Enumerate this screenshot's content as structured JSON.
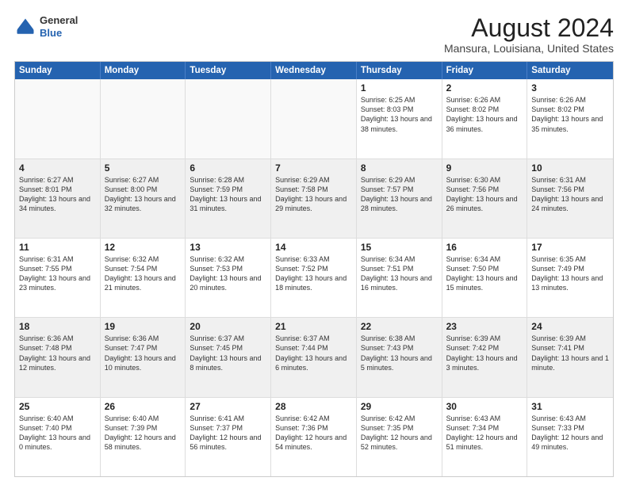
{
  "logo": {
    "general": "General",
    "blue": "Blue"
  },
  "title": "August 2024",
  "subtitle": "Mansura, Louisiana, United States",
  "header_days": [
    "Sunday",
    "Monday",
    "Tuesday",
    "Wednesday",
    "Thursday",
    "Friday",
    "Saturday"
  ],
  "rows": [
    [
      {
        "day": "",
        "empty": true,
        "text": ""
      },
      {
        "day": "",
        "empty": true,
        "text": ""
      },
      {
        "day": "",
        "empty": true,
        "text": ""
      },
      {
        "day": "",
        "empty": true,
        "text": ""
      },
      {
        "day": "1",
        "text": "Sunrise: 6:25 AM\nSunset: 8:03 PM\nDaylight: 13 hours\nand 38 minutes."
      },
      {
        "day": "2",
        "text": "Sunrise: 6:26 AM\nSunset: 8:02 PM\nDaylight: 13 hours\nand 36 minutes."
      },
      {
        "day": "3",
        "text": "Sunrise: 6:26 AM\nSunset: 8:02 PM\nDaylight: 13 hours\nand 35 minutes."
      }
    ],
    [
      {
        "day": "4",
        "text": "Sunrise: 6:27 AM\nSunset: 8:01 PM\nDaylight: 13 hours\nand 34 minutes."
      },
      {
        "day": "5",
        "text": "Sunrise: 6:27 AM\nSunset: 8:00 PM\nDaylight: 13 hours\nand 32 minutes."
      },
      {
        "day": "6",
        "text": "Sunrise: 6:28 AM\nSunset: 7:59 PM\nDaylight: 13 hours\nand 31 minutes."
      },
      {
        "day": "7",
        "text": "Sunrise: 6:29 AM\nSunset: 7:58 PM\nDaylight: 13 hours\nand 29 minutes."
      },
      {
        "day": "8",
        "text": "Sunrise: 6:29 AM\nSunset: 7:57 PM\nDaylight: 13 hours\nand 28 minutes."
      },
      {
        "day": "9",
        "text": "Sunrise: 6:30 AM\nSunset: 7:56 PM\nDaylight: 13 hours\nand 26 minutes."
      },
      {
        "day": "10",
        "text": "Sunrise: 6:31 AM\nSunset: 7:56 PM\nDaylight: 13 hours\nand 24 minutes."
      }
    ],
    [
      {
        "day": "11",
        "text": "Sunrise: 6:31 AM\nSunset: 7:55 PM\nDaylight: 13 hours\nand 23 minutes."
      },
      {
        "day": "12",
        "text": "Sunrise: 6:32 AM\nSunset: 7:54 PM\nDaylight: 13 hours\nand 21 minutes."
      },
      {
        "day": "13",
        "text": "Sunrise: 6:32 AM\nSunset: 7:53 PM\nDaylight: 13 hours\nand 20 minutes."
      },
      {
        "day": "14",
        "text": "Sunrise: 6:33 AM\nSunset: 7:52 PM\nDaylight: 13 hours\nand 18 minutes."
      },
      {
        "day": "15",
        "text": "Sunrise: 6:34 AM\nSunset: 7:51 PM\nDaylight: 13 hours\nand 16 minutes."
      },
      {
        "day": "16",
        "text": "Sunrise: 6:34 AM\nSunset: 7:50 PM\nDaylight: 13 hours\nand 15 minutes."
      },
      {
        "day": "17",
        "text": "Sunrise: 6:35 AM\nSunset: 7:49 PM\nDaylight: 13 hours\nand 13 minutes."
      }
    ],
    [
      {
        "day": "18",
        "text": "Sunrise: 6:36 AM\nSunset: 7:48 PM\nDaylight: 13 hours\nand 12 minutes."
      },
      {
        "day": "19",
        "text": "Sunrise: 6:36 AM\nSunset: 7:47 PM\nDaylight: 13 hours\nand 10 minutes."
      },
      {
        "day": "20",
        "text": "Sunrise: 6:37 AM\nSunset: 7:45 PM\nDaylight: 13 hours\nand 8 minutes."
      },
      {
        "day": "21",
        "text": "Sunrise: 6:37 AM\nSunset: 7:44 PM\nDaylight: 13 hours\nand 6 minutes."
      },
      {
        "day": "22",
        "text": "Sunrise: 6:38 AM\nSunset: 7:43 PM\nDaylight: 13 hours\nand 5 minutes."
      },
      {
        "day": "23",
        "text": "Sunrise: 6:39 AM\nSunset: 7:42 PM\nDaylight: 13 hours\nand 3 minutes."
      },
      {
        "day": "24",
        "text": "Sunrise: 6:39 AM\nSunset: 7:41 PM\nDaylight: 13 hours\nand 1 minute."
      }
    ],
    [
      {
        "day": "25",
        "text": "Sunrise: 6:40 AM\nSunset: 7:40 PM\nDaylight: 13 hours\nand 0 minutes."
      },
      {
        "day": "26",
        "text": "Sunrise: 6:40 AM\nSunset: 7:39 PM\nDaylight: 12 hours\nand 58 minutes."
      },
      {
        "day": "27",
        "text": "Sunrise: 6:41 AM\nSunset: 7:37 PM\nDaylight: 12 hours\nand 56 minutes."
      },
      {
        "day": "28",
        "text": "Sunrise: 6:42 AM\nSunset: 7:36 PM\nDaylight: 12 hours\nand 54 minutes."
      },
      {
        "day": "29",
        "text": "Sunrise: 6:42 AM\nSunset: 7:35 PM\nDaylight: 12 hours\nand 52 minutes."
      },
      {
        "day": "30",
        "text": "Sunrise: 6:43 AM\nSunset: 7:34 PM\nDaylight: 12 hours\nand 51 minutes."
      },
      {
        "day": "31",
        "text": "Sunrise: 6:43 AM\nSunset: 7:33 PM\nDaylight: 12 hours\nand 49 minutes."
      }
    ]
  ]
}
